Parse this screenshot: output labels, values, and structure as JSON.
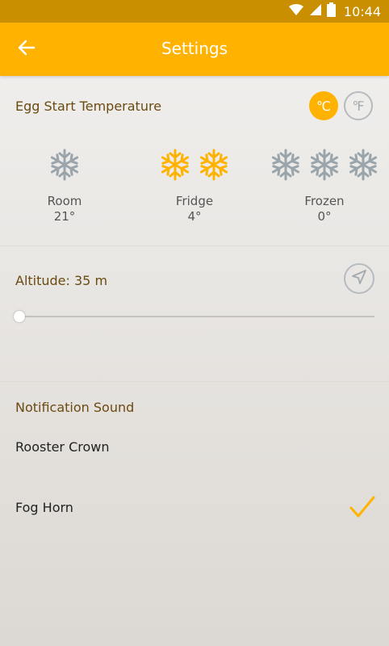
{
  "status_bar": {
    "time": "10:44",
    "icons": [
      "wifi-icon",
      "signal-icon",
      "battery-icon"
    ]
  },
  "app_bar": {
    "title": "Settings",
    "back_icon": "arrow-left-icon"
  },
  "egg_temperature": {
    "title": "Egg Start Temperature",
    "units": [
      {
        "label": "℃",
        "selected": true
      },
      {
        "label": "℉",
        "selected": false
      }
    ],
    "options": [
      {
        "name": "Room",
        "value": "21°",
        "flakes": 1,
        "selected": false
      },
      {
        "name": "Fridge",
        "value": "4°",
        "flakes": 2,
        "selected": true
      },
      {
        "name": "Frozen",
        "value": "0°",
        "flakes": 3,
        "selected": false
      }
    ]
  },
  "altitude": {
    "label": "Altitude: 35 m",
    "locate_icon": "navigation-arrow-icon",
    "slider_fraction": 0.01
  },
  "notification_sound": {
    "title": "Notification Sound",
    "options": [
      {
        "label": "Rooster Crown",
        "selected": false
      },
      {
        "label": "Fog Horn",
        "selected": true
      }
    ]
  },
  "colors": {
    "accent": "#ffb300",
    "status_bar": "#c98f00",
    "section_title": "#6b4a12",
    "inactive_icon": "#a3a9ae"
  }
}
